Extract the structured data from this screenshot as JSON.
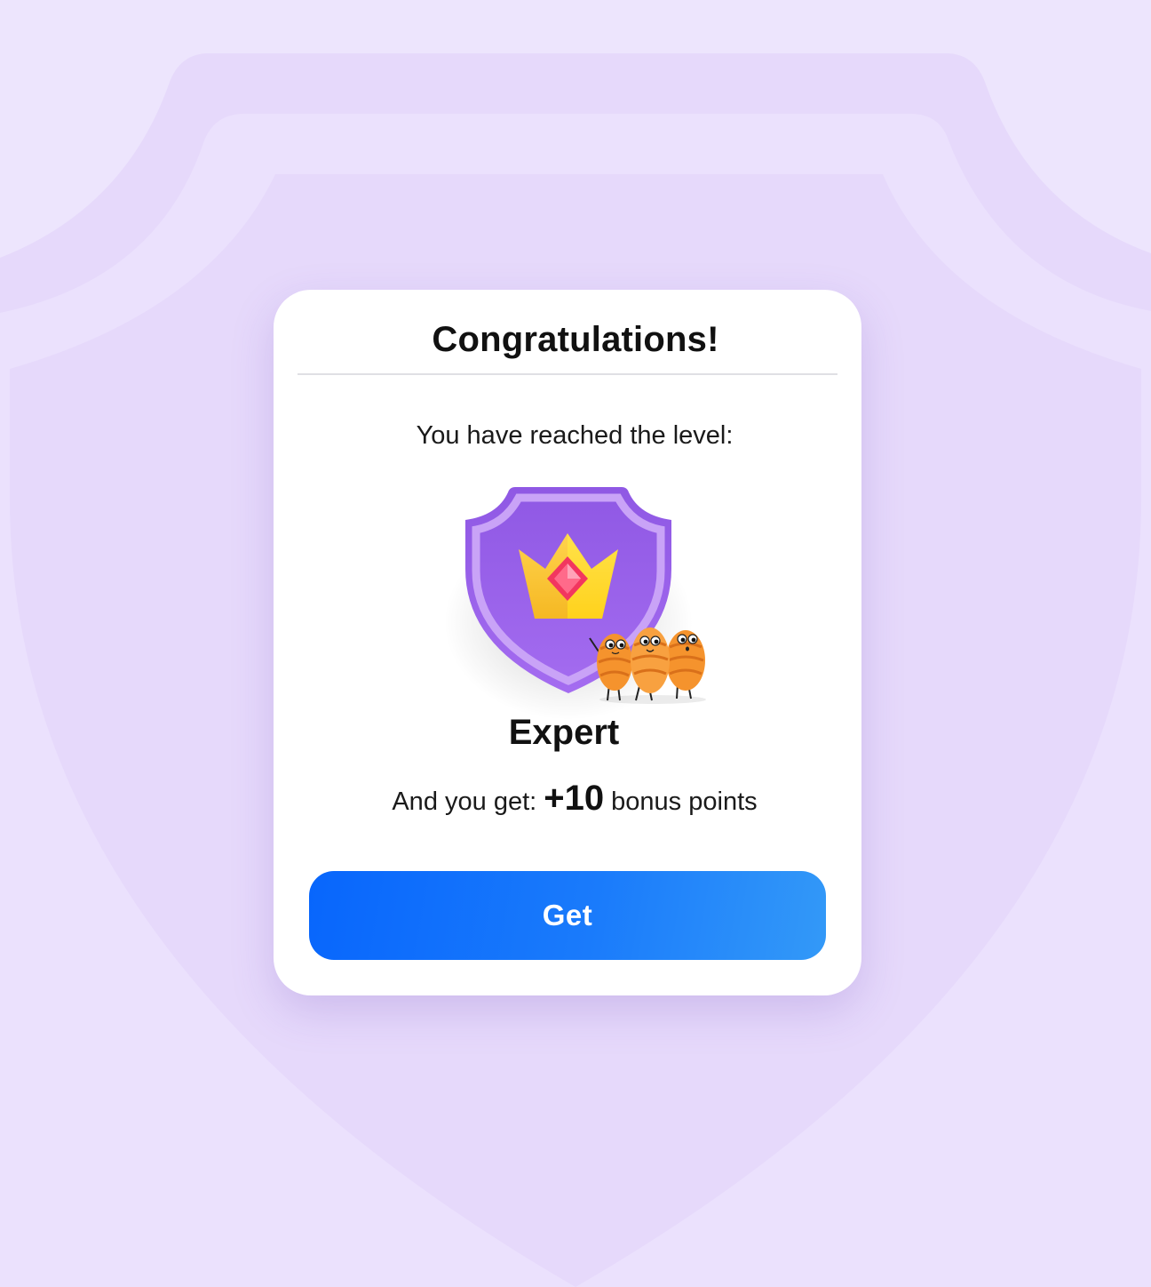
{
  "modal": {
    "title": "Congratulations!",
    "subtitle": "You have reached the level:",
    "level": {
      "name": "Expert",
      "badge_icon": "shield-crown-icon",
      "mascot": "croissant-mascots"
    },
    "bonus": {
      "prefix": "And you get:",
      "amount": "+10",
      "suffix": "bonus points"
    },
    "button_label": "Get"
  },
  "colors": {
    "background": "#ede5fd",
    "shield_purple": "#9b5de5",
    "crown_gold": "#ffc533",
    "gem_red": "#f5335e",
    "button_start": "#0866fc",
    "button_end": "#3399f8"
  }
}
